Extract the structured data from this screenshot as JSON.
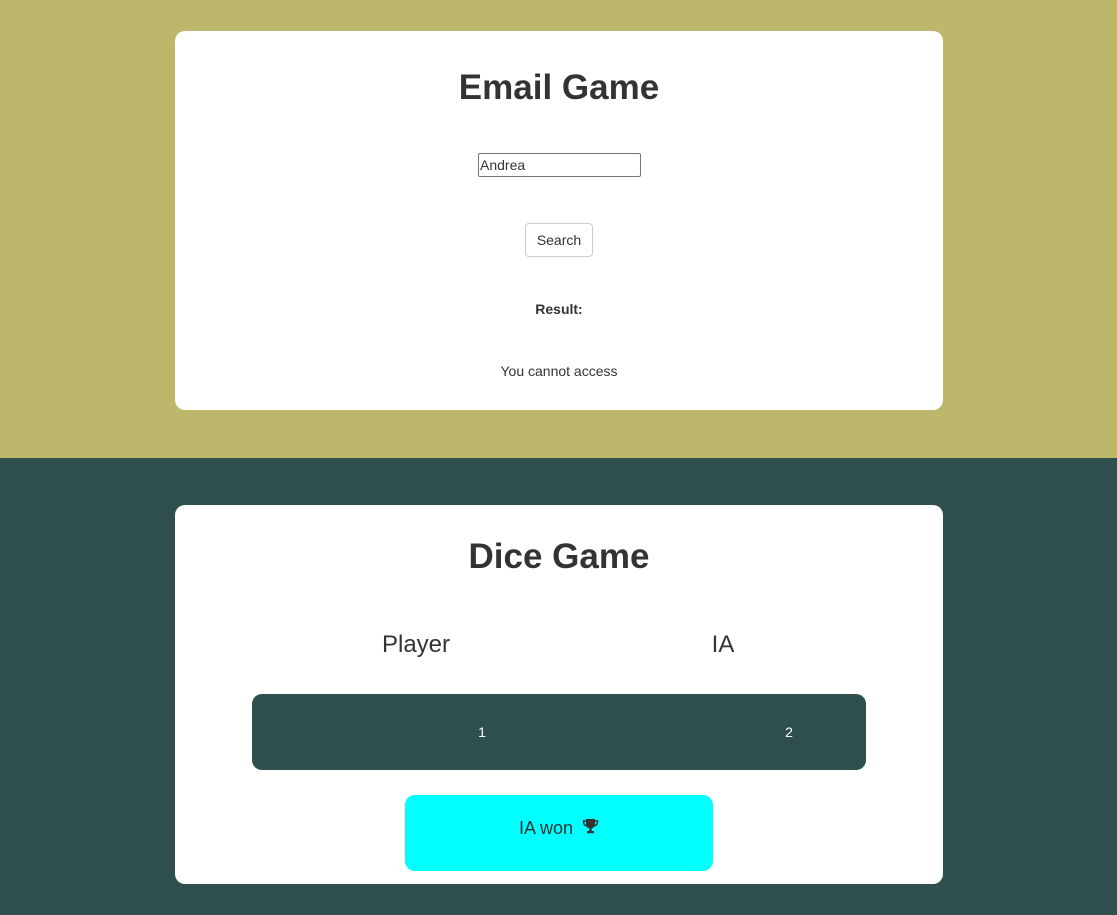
{
  "email_game": {
    "title": "Email Game",
    "input_value": "Andrea",
    "search_label": "Search",
    "result_label": "Result:",
    "result_text": "You cannot access"
  },
  "dice_game": {
    "title": "Dice Game",
    "player_label": "Player",
    "ia_label": "IA",
    "player_score": "1",
    "ia_score": "2",
    "winner_text": "IA won",
    "winner_icon": "trophy-icon"
  },
  "colors": {
    "top_background": "#bdb76b",
    "bottom_background": "#2f4f4f",
    "card_background": "#ffffff",
    "scoreboard_background": "#2f4f4f",
    "winner_background": "#00ffff",
    "text": "#333333"
  }
}
